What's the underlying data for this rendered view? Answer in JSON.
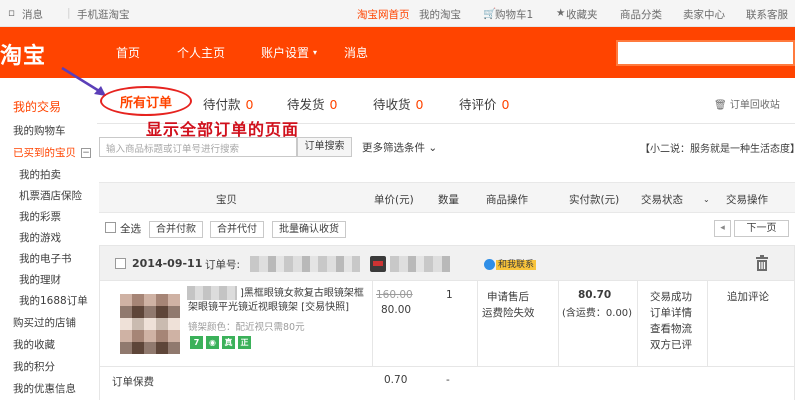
{
  "topbar": {
    "messages": "消息",
    "mobile": "手机逛淘宝",
    "home": "淘宝网首页",
    "my_taobao": "我的淘宝",
    "cart": "购物车1",
    "favorites": "收藏夹",
    "categories": "商品分类",
    "seller": "卖家中心",
    "service": "联系客服"
  },
  "nav": {
    "logo": "淘宝",
    "home": "首页",
    "profile": "个人主页",
    "account": "账户设置",
    "messages": "消息"
  },
  "sidebar": {
    "title": "我的交易",
    "items": [
      "我的购物车",
      "已买到的宝贝",
      "我的拍卖",
      "机票酒店保险",
      "我的彩票",
      "我的游戏",
      "我的电子书",
      "我的理财",
      "我的1688订单",
      "购买过的店铺",
      "我的收藏",
      "我的积分",
      "我的优惠信息"
    ]
  },
  "tabs": {
    "all": "所有订单",
    "pay": "待付款",
    "pay_n": "0",
    "ship": "待发货",
    "ship_n": "0",
    "receive": "待收货",
    "receive_n": "0",
    "review": "待评价",
    "review_n": "0",
    "recycle": "订单回收站"
  },
  "annotation": "显示全部订单的页面",
  "search": {
    "placeholder": "输入商品标题或订单号进行搜索",
    "button": "订单搜索",
    "more": "更多筛选条件",
    "slogan": "【小二说：服务就是一种生活态度】"
  },
  "table_header": {
    "item": "宝贝",
    "price": "单价(元)",
    "qty": "数量",
    "ops": "商品操作",
    "paid": "实付款(元)",
    "status": "交易状态",
    "actions": "交易操作"
  },
  "batch": {
    "select_all": "全选",
    "merge_pay": "合并付款",
    "merge_proxy": "合并代付",
    "confirm": "批量确认收货",
    "next": "下一页"
  },
  "order": {
    "date": "2014-09-11",
    "number_label": "订单号:",
    "contact": "和我联系",
    "title": "]黑框眼镜女款复古眼镜架框架眼镜平光镜近视眼镜架 [交易快照]",
    "spec": "镜架颜色：配近视只需80元",
    "original_price": "160.00",
    "price": "80.00",
    "qty": "1",
    "after_sale": "申请售后",
    "freight_insurance": "运费险失效",
    "paid": "80.70",
    "shipping": "(含运费：0.00)",
    "status": [
      "交易成功",
      "订单详情",
      "查看物流",
      "双方已评"
    ],
    "action": "追加评论",
    "insurance_label": "订单保费",
    "insurance_price": "0.70",
    "insurance_qty": "-"
  },
  "colors": {
    "brand": "#ff4400",
    "annotation": "#d0101c"
  }
}
